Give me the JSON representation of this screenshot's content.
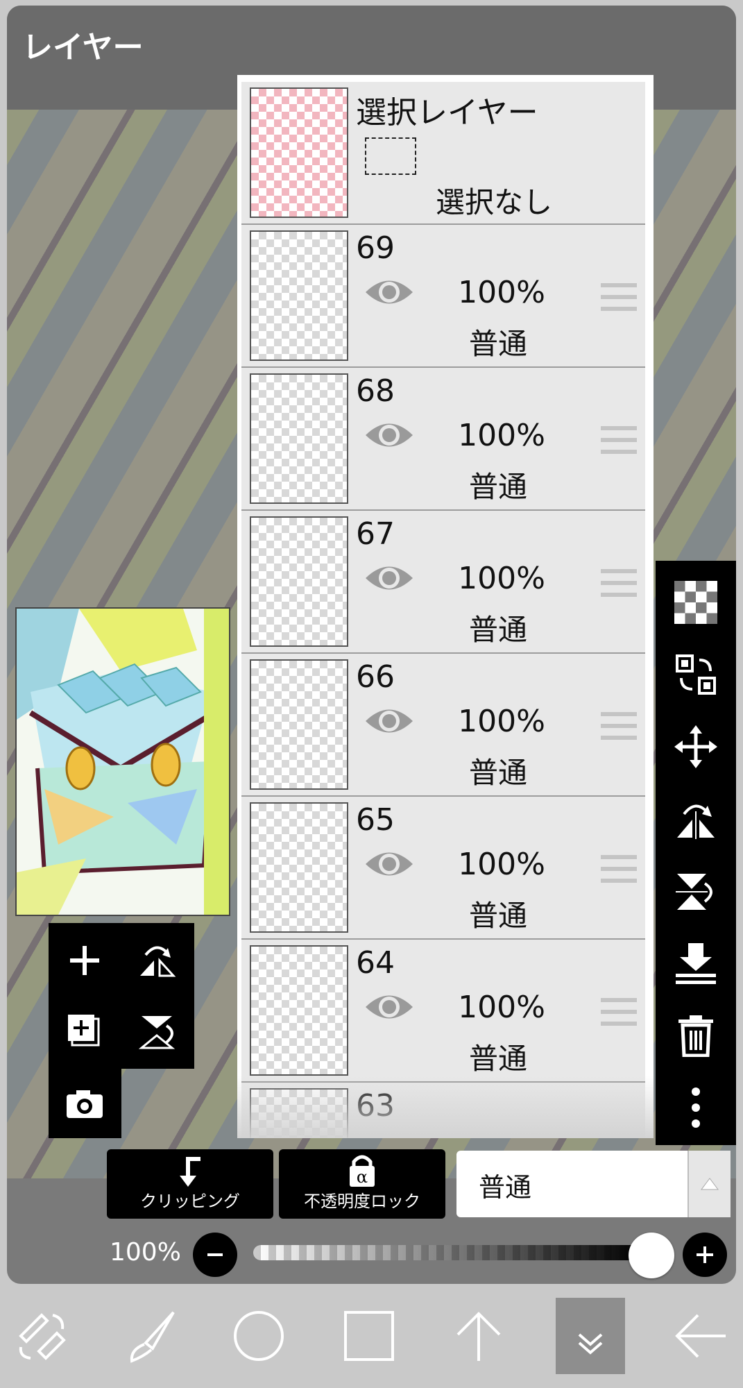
{
  "header": {
    "title": "レイヤー"
  },
  "selection_layer": {
    "name": "選択レイヤー",
    "status": "選択なし"
  },
  "layers": [
    {
      "name": "69",
      "visible_icon": "eye-icon",
      "opacity": "100%",
      "blend": "普通"
    },
    {
      "name": "68",
      "visible_icon": "eye-icon",
      "opacity": "100%",
      "blend": "普通"
    },
    {
      "name": "67",
      "visible_icon": "eye-icon",
      "opacity": "100%",
      "blend": "普通"
    },
    {
      "name": "66",
      "visible_icon": "eye-icon",
      "opacity": "100%",
      "blend": "普通"
    },
    {
      "name": "65",
      "visible_icon": "eye-icon",
      "opacity": "100%",
      "blend": "普通"
    },
    {
      "name": "64",
      "visible_icon": "eye-icon",
      "opacity": "100%",
      "blend": "普通"
    },
    {
      "name": "63"
    }
  ],
  "actions": {
    "clipping_label": "クリッピング",
    "alpha_lock_label": "不透明度ロック",
    "blend_mode_value": "普通"
  },
  "opacity": {
    "label": "100%",
    "value": 1.0
  },
  "right_toolbar_icons": [
    "checker-icon",
    "swap-layer-icon",
    "move-icon",
    "flip-horizontal-icon",
    "flip-vertical-icon",
    "merge-down-icon",
    "trash-icon",
    "more-icon"
  ],
  "left_toolbar_icons": [
    "add-layer-icon",
    "flip-h-icon",
    "add-special-layer-icon",
    "flip-v-icon",
    "camera-icon"
  ],
  "bottom_toolbar_icons": [
    "tools-icon",
    "brush-icon",
    "color-circle-icon",
    "layer-square-icon",
    "upload-icon",
    "collapse-icon",
    "back-icon"
  ],
  "colors": {
    "panel": "#7a7a7a",
    "header": "#6b6b6b",
    "row_bg": "#e8e8e8",
    "selection_checker": "#f2b6bf"
  }
}
